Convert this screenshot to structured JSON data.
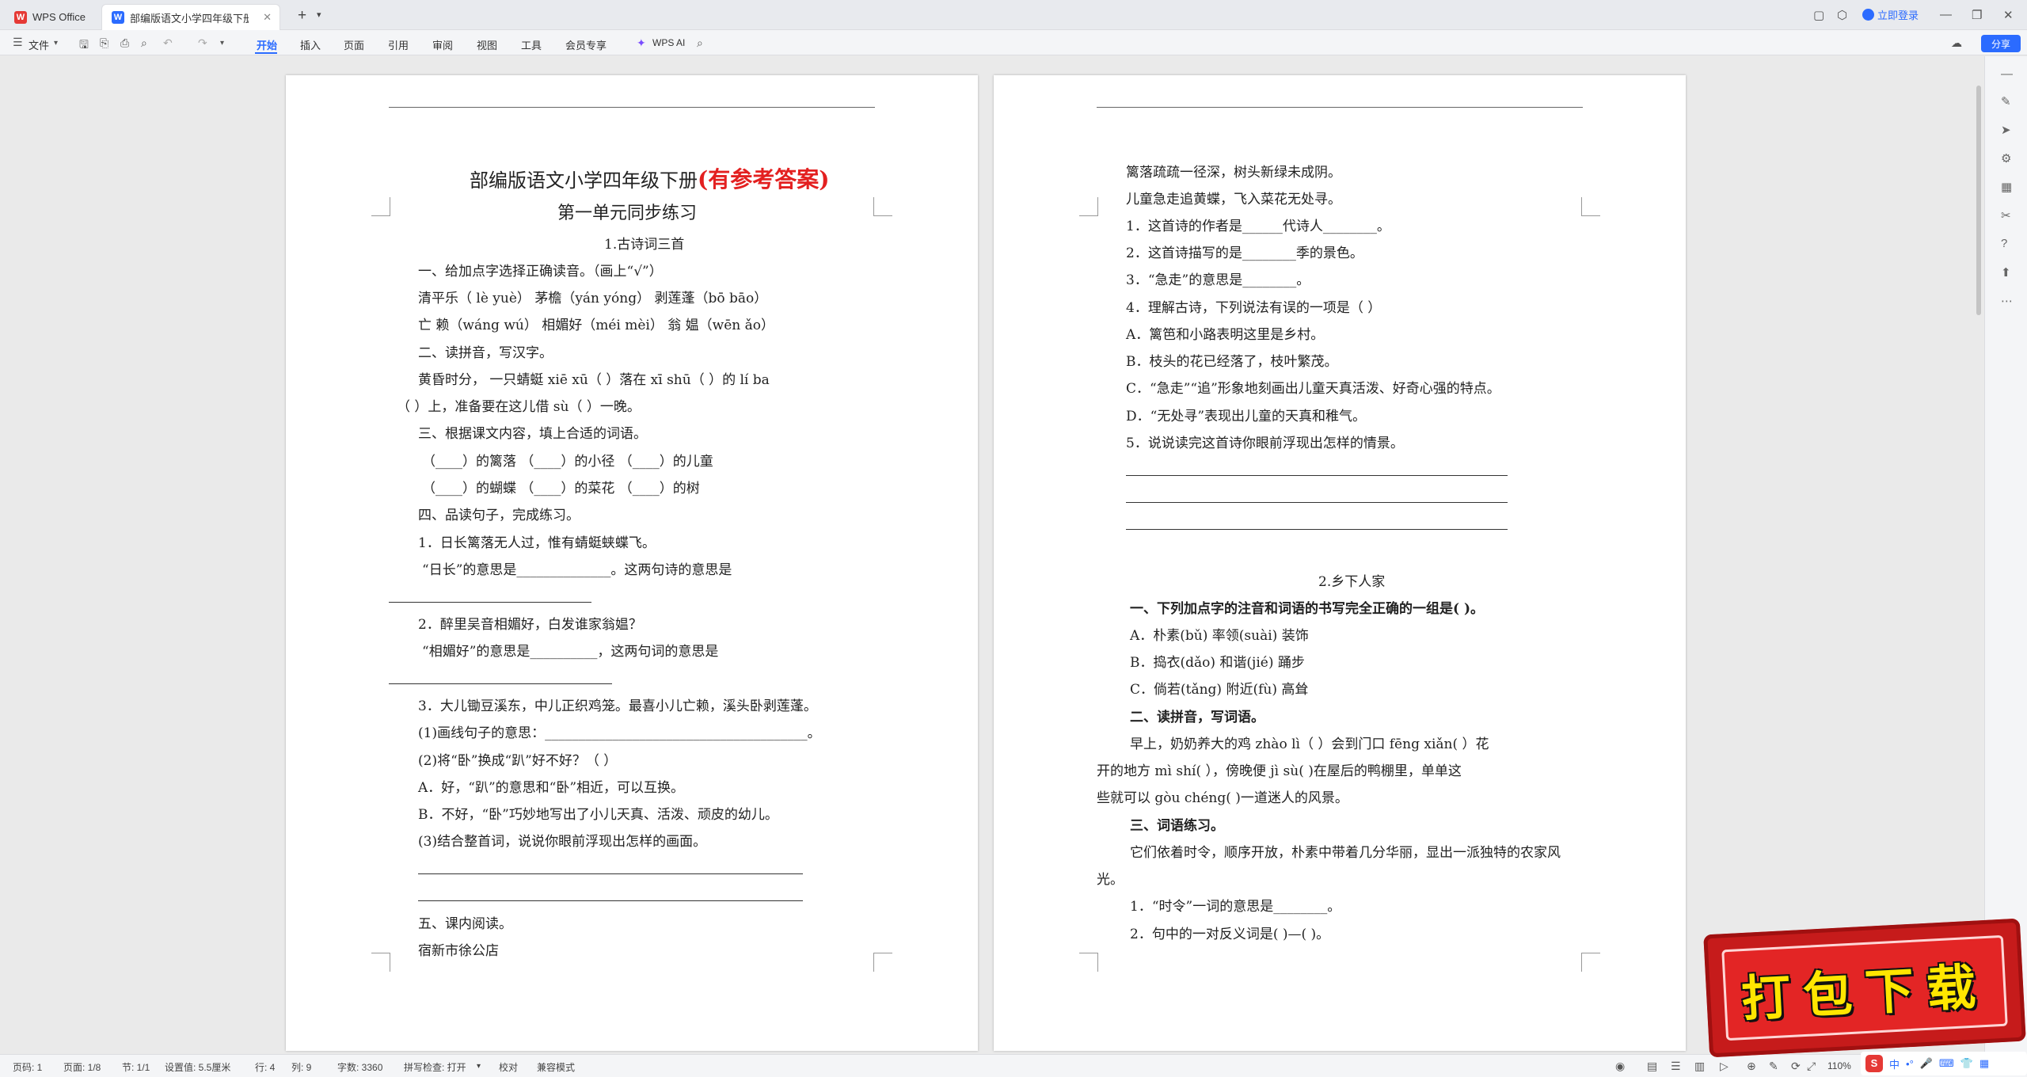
{
  "titlebar": {
    "home_tab": "WPS Office",
    "doc_tab": "部编版语文小学四年级下册新",
    "login": "立即登录"
  },
  "menu": {
    "file": "文件",
    "tabs": [
      "开始",
      "插入",
      "页面",
      "引用",
      "审阅",
      "视图",
      "工具",
      "会员专享"
    ],
    "ai": "WPS AI",
    "share": "分享"
  },
  "page1": {
    "title": "部编版语文小学四年级下册",
    "title_red": "(有参考答案)",
    "subtitle": "第一单元同步练习",
    "lesson": "1.古诗词三首",
    "lines": [
      "一、给加点字选择正确读音。（画上“√”）",
      "清平乐（ lè   yuè）      茅檐（yán   yóng）     剥莲蓬（bō bāo）",
      "亡   赖（wáng    wú）      相媚好（méi mèi）      翁   媪（wēn ǎo）",
      "二、读拼音，写汉字。",
      "黄昏时分，  一只蜻蜓 xiē xū（         ）落在 xī  shū（          ）的 lí ba",
      "（           ）上，准备要在这儿借 sù（      ）一晚。",
      "三、根据课文内容，填上合适的词语。",
      "（____）的篱落    （____）的小径    （____）的儿童",
      "（____）的蝴蝶    （____）的菜花    （____）的树",
      "四、品读句子，完成练习。",
      "1．日长篱落无人过，惟有蜻蜓蛱蝶飞。",
      "“日长”的意思是______________。这两句诗的意思是",
      "2．醉里吴音相媚好，白发谁家翁媪？",
      "“相媚好”的意思是__________，这两句词的意思是",
      "3．大儿锄豆溪东，中儿正织鸡笼。最喜小儿亡赖，溪头卧剥莲蓬。",
      "(1)画线句子的意思：_______________________________________。",
      "(2)将“卧”换成“趴”好不好？（     ）",
      "A．好，“趴”的意思和“卧”相近，可以互换。",
      "B．不好，“卧”巧妙地写出了小儿天真、活泼、顽皮的幼儿。",
      "(3)结合整首词，说说你眼前浮现出怎样的画面。",
      "五、课内阅读。",
      "宿新市徐公店"
    ]
  },
  "page2": {
    "lines_top": [
      "篱落疏疏一径深，树头新绿未成阴。",
      "儿童急走追黄蝶，飞入菜花无处寻。",
      "1．这首诗的作者是______代诗人________。",
      "2．这首诗描写的是________季的景色。",
      "3．“急走”的意思是________。",
      "4．理解古诗，下列说法有误的一项是（     ）",
      "A．篱笆和小路表明这里是乡村。",
      "B．枝头的花已经落了，枝叶繁茂。",
      "C．“急走”“追”形象地刻画出儿童天真活泼、好奇心强的特点。",
      "D．“无处寻”表现出儿童的天真和稚气。",
      "5．说说读完这首诗你眼前浮现出怎样的情景。"
    ],
    "lesson2": "2.乡下人家",
    "q1": "一、下列加点字的注音和词语的书写完全正确的一组是(     )。",
    "opts": [
      "A．朴素(bǔ)         率领(suài)        装饰",
      "B．捣衣(dǎo)         和谐(jié)         踊步",
      "C．倘若(tǎng)        附近(fù)          高耸"
    ],
    "q2": "二、读拼音，写词语。",
    "p2a": "早上，奶奶养大的鸡 zhào lì（          ）会到门口 fēng xiǎn(           ）花",
    "p2b": "开的地方 mì shí(           ），傍晚便 jì sù(           )在屋后的鸭棚里，单单这",
    "p2c": "些就可以 gòu chéng(           )一道迷人的风景。",
    "q3": "三、词语练习。",
    "p3a": "它们依着时令，顺序开放，朴素中带着几分华丽，显出一派独特的农家风",
    "p3b": "光。",
    "p3c": "1．“时令”一词的意思是________。",
    "p3d": "2．句中的一对反义词是(        )—(        )。"
  },
  "status": {
    "page_no": "页码: 1",
    "page_of": "页面: 1/8",
    "section": "节: 1/1",
    "setting": "设置值: 5.5厘米",
    "row": "行: 4",
    "col": "列: 9",
    "words": "字数: 3360",
    "spell": "拼写检查: 打开",
    "proof": "校对",
    "compat": "兼容模式",
    "zoom": "110%"
  },
  "ime": {
    "s": "S",
    "lang": "中"
  },
  "promo": {
    "text": "打包下载"
  }
}
